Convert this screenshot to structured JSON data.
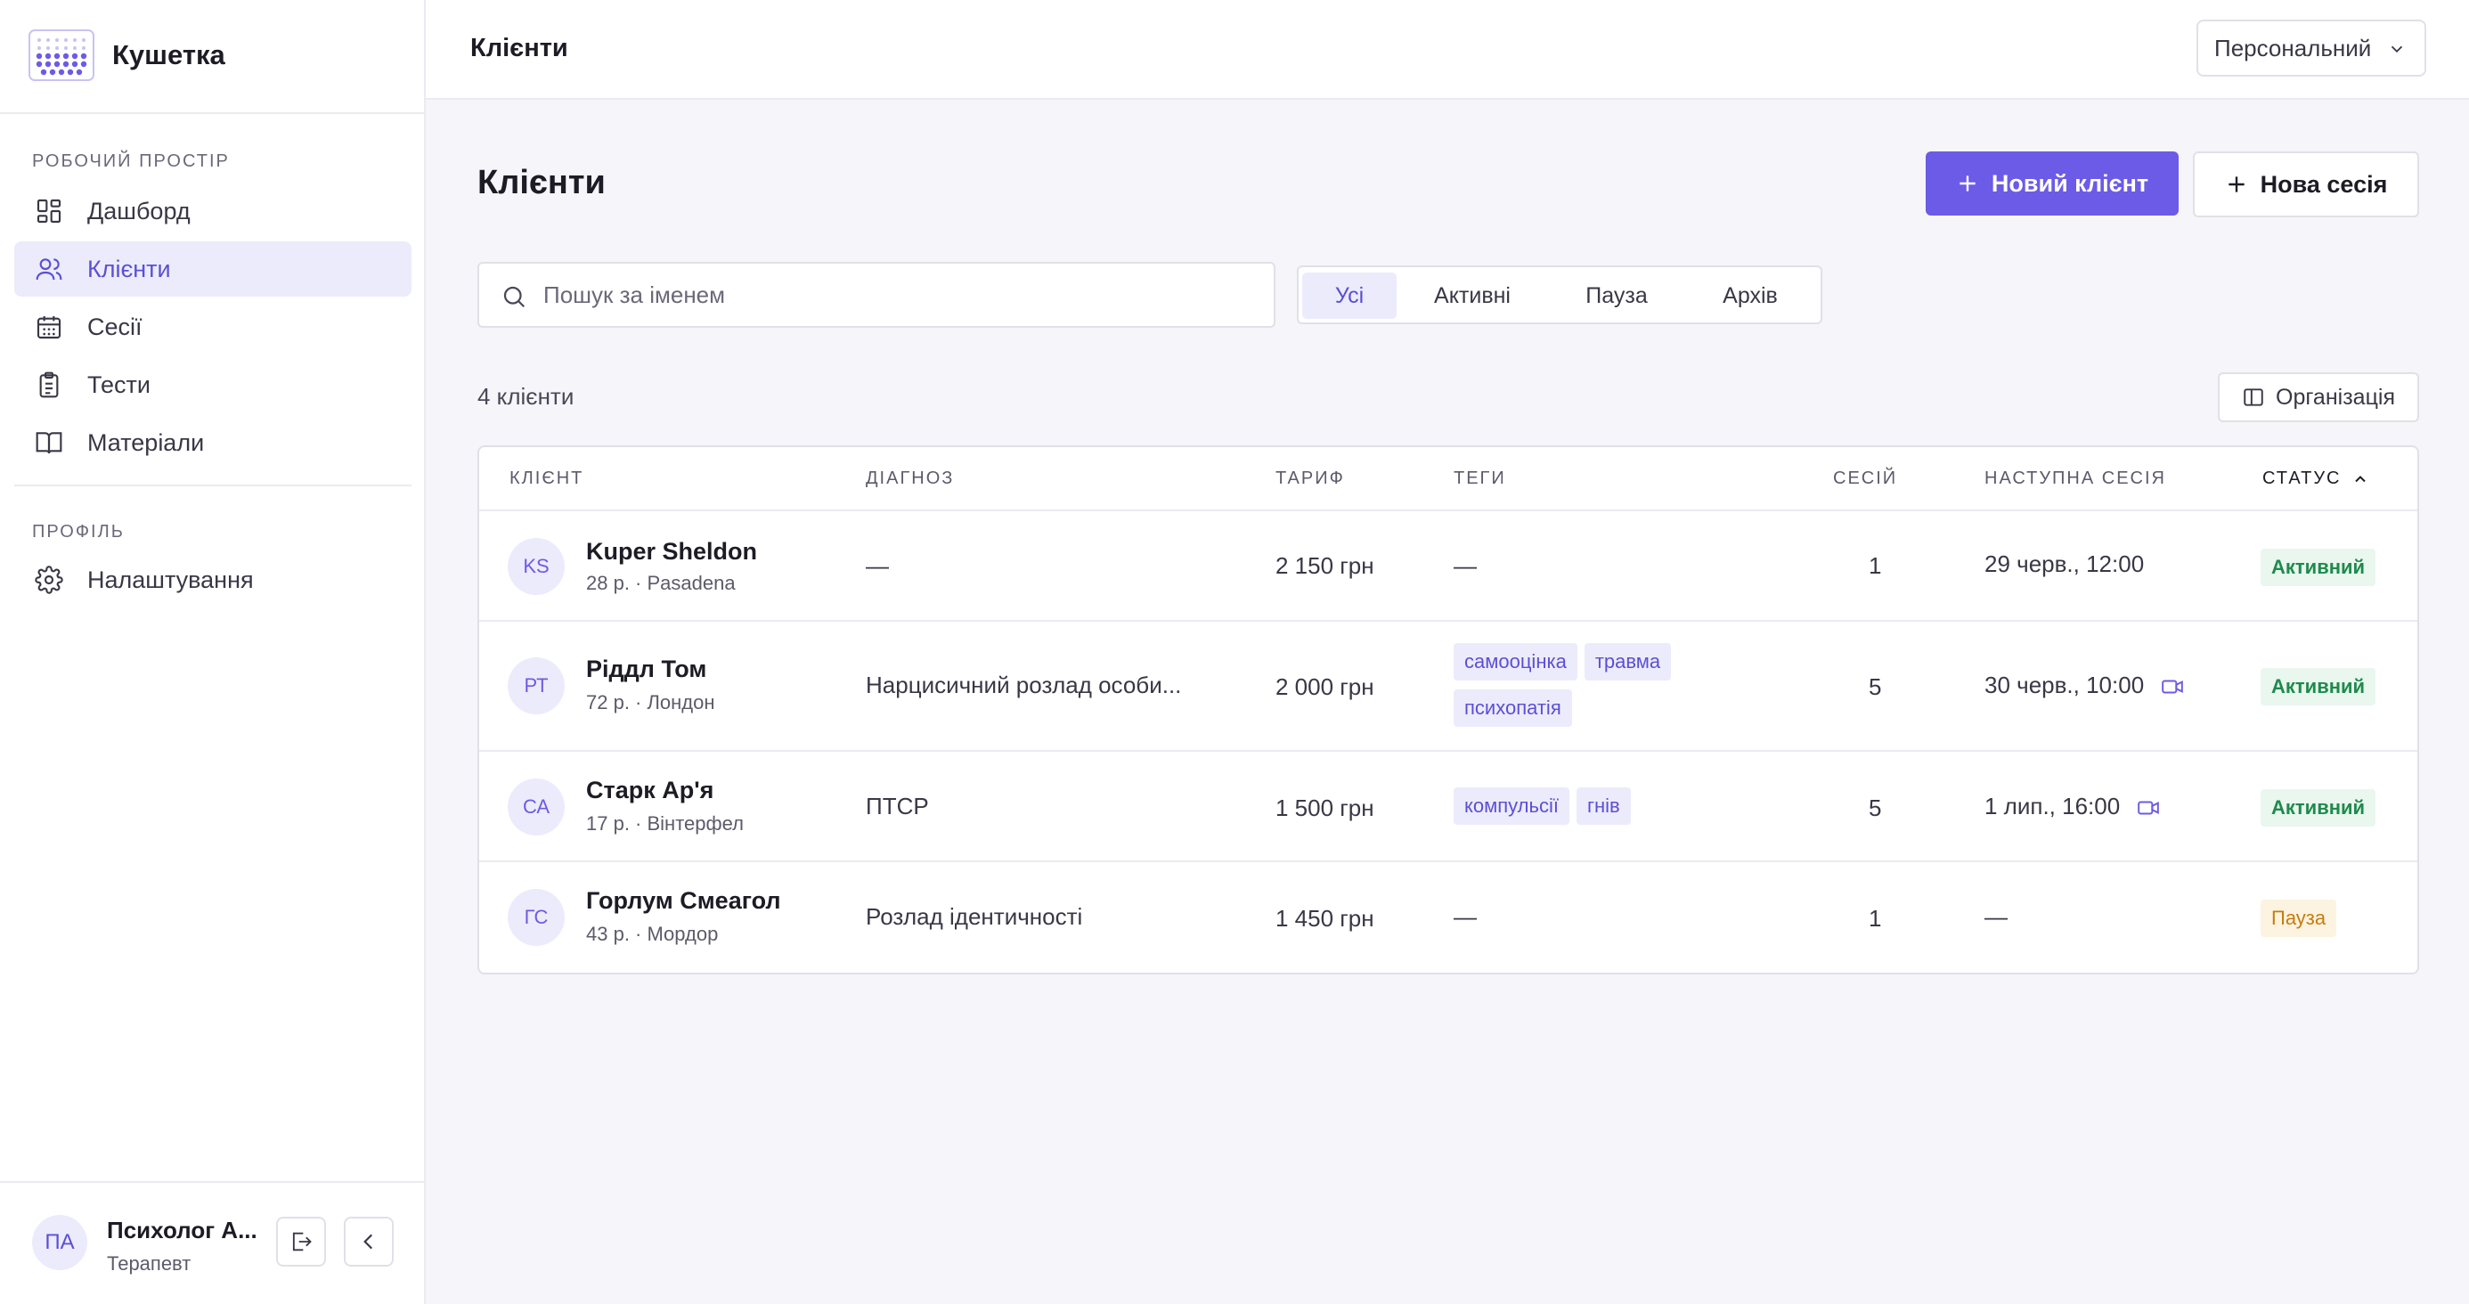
{
  "brand": {
    "name": "Кушетка",
    "logo_icon": "calendar-grid-logo"
  },
  "sidebar": {
    "workspace_label": "РОБОЧИЙ ПРОСТІР",
    "items": [
      {
        "label": "Дашборд",
        "icon": "dashboard-icon"
      },
      {
        "label": "Клієнти",
        "icon": "users-icon",
        "active": true
      },
      {
        "label": "Сесії",
        "icon": "calendar-icon"
      },
      {
        "label": "Тести",
        "icon": "clipboard-icon"
      },
      {
        "label": "Матеріали",
        "icon": "book-icon"
      }
    ],
    "profile_label": "ПРОФІЛЬ",
    "profile_items": [
      {
        "label": "Налаштування",
        "icon": "gear-icon"
      }
    ],
    "user": {
      "initials": "ПА",
      "name": "Психолог А...",
      "role": "Терапевт"
    }
  },
  "topbar": {
    "title": "Клієнти",
    "workspace_select": "Персональний"
  },
  "main": {
    "title": "Клієнти",
    "new_client_button": "Новий клієнт",
    "new_session_button": "Нова сесія",
    "search_placeholder": "Пошук за іменем",
    "filters": [
      "Усі",
      "Активні",
      "Пауза",
      "Архів"
    ],
    "active_filter": "Усі",
    "count": "4 клієнти",
    "org_button": "Організація"
  },
  "table": {
    "columns": {
      "client": "КЛІЄНТ",
      "diagnosis": "ДІАГНОЗ",
      "rate": "ТАРИФ",
      "tags": "ТЕГИ",
      "sessions": "СЕСІЙ",
      "next_session": "НАСТУПНА СЕСІЯ",
      "status": "СТАТУС"
    },
    "rows": [
      {
        "initials": "KS",
        "name": "Kuper Sheldon",
        "meta": "28 р. · Pasadena",
        "diagnosis": "—",
        "rate": "2 150 грн",
        "tags": [],
        "tags_empty": "—",
        "sessions": "1",
        "next": "29 черв., 12:00",
        "video": false,
        "status": "Активний",
        "status_type": "active"
      },
      {
        "initials": "РТ",
        "name": "Рiддл Том",
        "meta": "72 р. · Лондон",
        "diagnosis": "Нарцисичний розлад особи...",
        "rate": "2 000 грн",
        "tags": [
          "самооцінка",
          "травма",
          "психопатія"
        ],
        "sessions": "5",
        "next": "30 черв., 10:00",
        "video": true,
        "status": "Активний",
        "status_type": "active"
      },
      {
        "initials": "СА",
        "name": "Старк Ар'я",
        "meta": "17 р. · Вінтерфел",
        "diagnosis": "ПТСР",
        "rate": "1 500 грн",
        "tags": [
          "компульсії",
          "гнів"
        ],
        "sessions": "5",
        "next": "1 лип., 16:00",
        "video": true,
        "status": "Активний",
        "status_type": "active"
      },
      {
        "initials": "ГС",
        "name": "Горлум Смеагол",
        "meta": "43 р. · Мордор",
        "diagnosis": "Розлад ідентичності",
        "rate": "1 450 грн",
        "tags": [],
        "tags_empty": "—",
        "sessions": "1",
        "next": "—",
        "video": false,
        "status": "Пауза",
        "status_type": "pause"
      }
    ]
  },
  "colors": {
    "accent": "#6b5be6",
    "accent_soft": "#ecebfb",
    "active_status": "#1f8a4c",
    "pause_status": "#c77c0c"
  }
}
